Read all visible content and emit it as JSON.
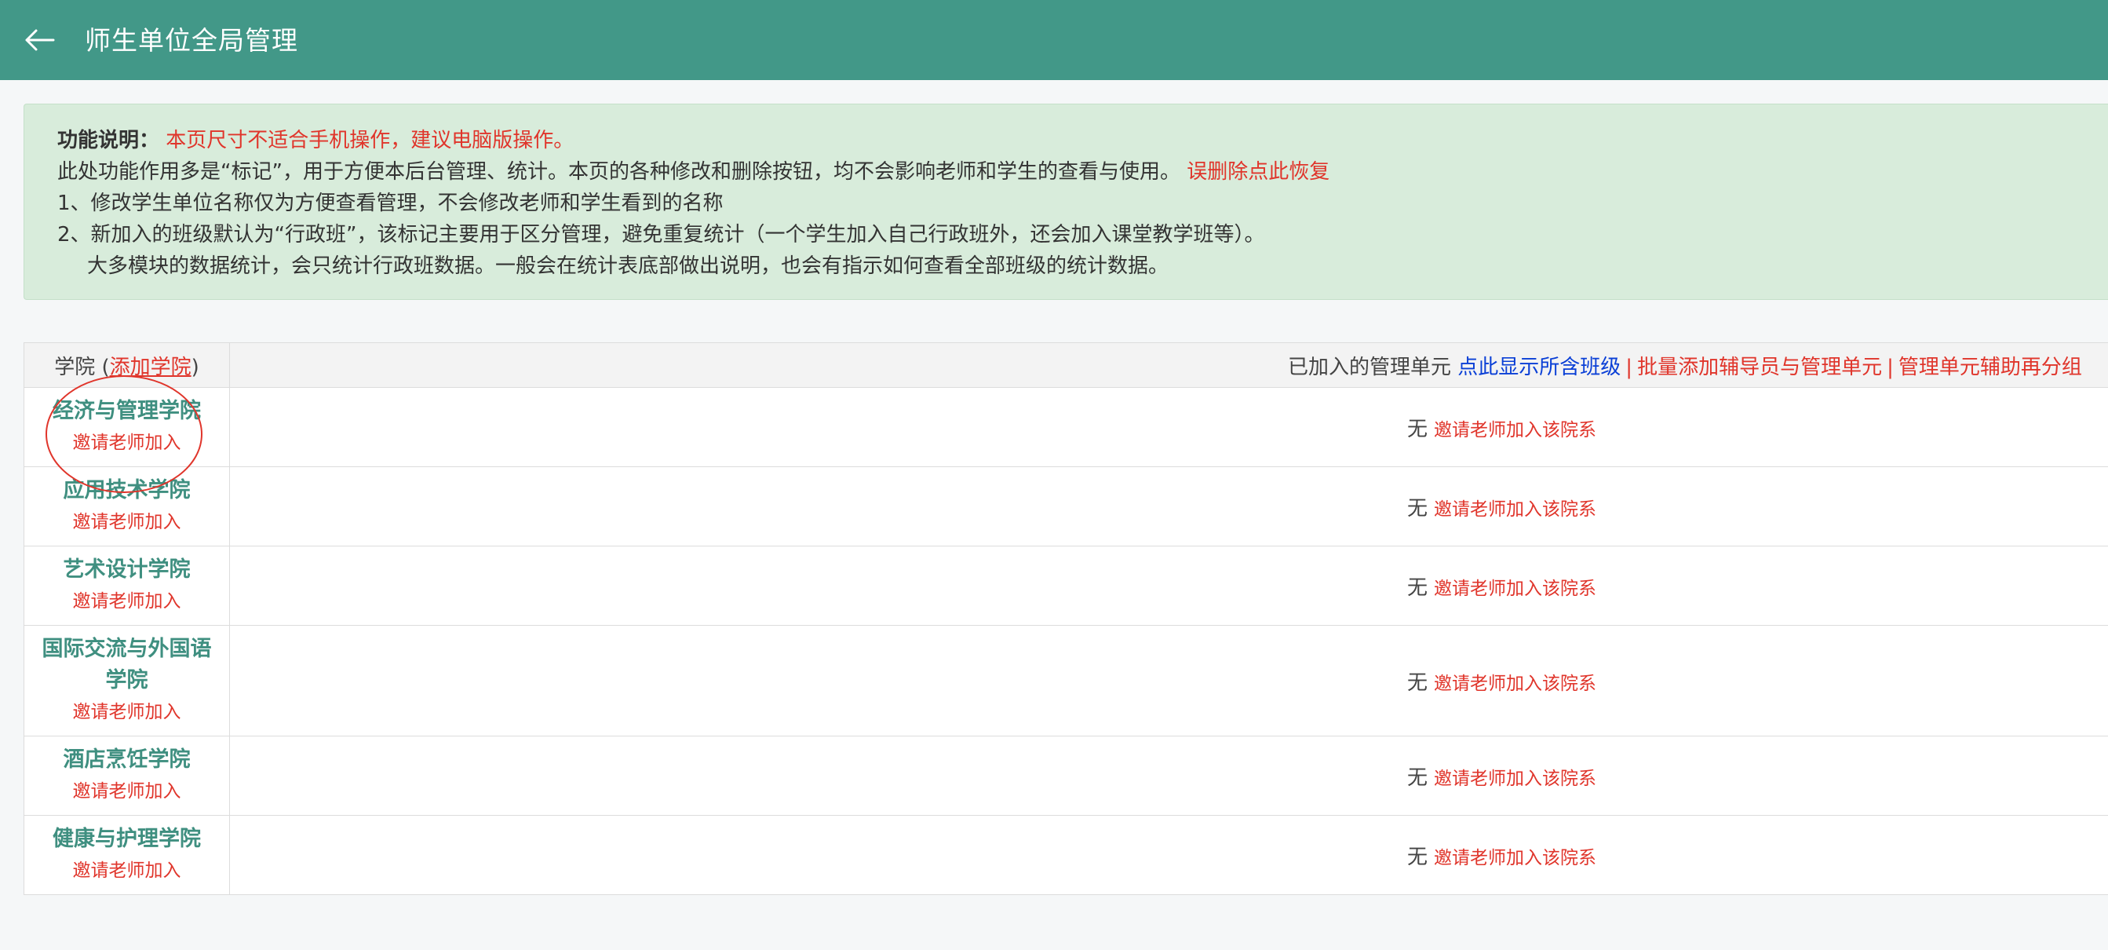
{
  "header": {
    "title": "师生单位全局管理",
    "back_icon": "arrow-left-icon"
  },
  "notice": {
    "label": "功能说明：",
    "warning": "本页尺寸不适合手机操作，建议电脑版操作。",
    "line2": "此处功能作用多是“标记”，用于方便本后台管理、统计。本页的各种修改和删除按钮，均不会影响老师和学生的查看与使用。",
    "restore_link": "误删除点此恢复",
    "line3": "1、修改学生单位名称仅为方便查看管理，不会修改老师和学生看到的名称",
    "line4": "2、新加入的班级默认为“行政班”，该标记主要用于区分管理，避免重复统计（一个学生加入自己行政班外，还会加入课堂教学班等）。",
    "line5": "大多模块的数据统计，会只统计行政班数据。一般会在统计表底部做出说明，也会有指示如何查看全部班级的统计数据。"
  },
  "table": {
    "col1_prefix": "学院 (",
    "col1_add_link": "添加学院",
    "col1_suffix": ")",
    "col2_label": "已加入的管理单元",
    "col2_show_link": "点此显示所含班级",
    "separator": "|",
    "col2_batch_link": "批量添加辅导员与管理单元",
    "col2_regroup_link": "管理单元辅助再分组",
    "rows": [
      {
        "name": "经济与管理学院",
        "invite": "邀请老师加入",
        "units": "无",
        "invite_dept": "邀请老师加入该院系"
      },
      {
        "name": "应用技术学院",
        "invite": "邀请老师加入",
        "units": "无",
        "invite_dept": "邀请老师加入该院系"
      },
      {
        "name": "艺术设计学院",
        "invite": "邀请老师加入",
        "units": "无",
        "invite_dept": "邀请老师加入该院系"
      },
      {
        "name": "国际交流与外国语学院",
        "invite": "邀请老师加入",
        "units": "无",
        "invite_dept": "邀请老师加入该院系"
      },
      {
        "name": "酒店烹饪学院",
        "invite": "邀请老师加入",
        "units": "无",
        "invite_dept": "邀请老师加入该院系"
      },
      {
        "name": "健康与护理学院",
        "invite": "邀请老师加入",
        "units": "无",
        "invite_dept": "邀请老师加入该院系"
      }
    ]
  },
  "colors": {
    "header_bg": "#429888",
    "notice_bg": "#d8ecdb",
    "accent_red": "#e0352b",
    "link_blue": "#0a3fd6",
    "college_green": "#3f8f80"
  }
}
